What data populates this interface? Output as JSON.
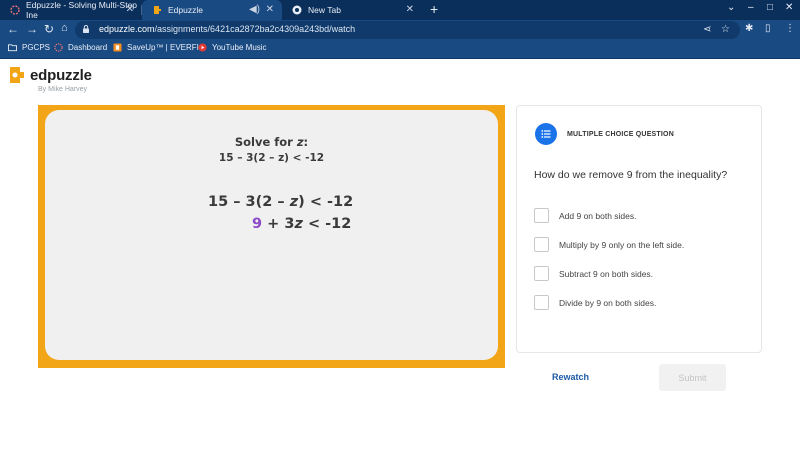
{
  "browser": {
    "tabs": [
      {
        "title": "Edpuzzle - Solving Multi-Step Ine",
        "icon": "edpuzzle-loading-icon"
      },
      {
        "title": "Edpuzzle",
        "icon": "edpuzzle-icon"
      },
      {
        "title": "New Tab",
        "icon": "chrome-icon"
      }
    ],
    "new_tab": "+",
    "url_host": "edpuzzle.com",
    "url_path": "/assignments/6421ca2872ba2c4309a243bd/watch",
    "bookmarks": [
      {
        "label": "PGCPS",
        "icon": "folder-icon"
      },
      {
        "label": "Dashboard",
        "icon": "dashboard-icon"
      },
      {
        "label": "SaveUp™ | EVERFI...",
        "icon": "saveup-icon"
      },
      {
        "label": "YouTube Music",
        "icon": "youtube-music-icon"
      }
    ],
    "colors": {
      "frame": "#0b2f5b",
      "toolbar": "#1a4a82"
    }
  },
  "app": {
    "brand": "edpuzzle",
    "byline": "By Mike Harvey",
    "brand_color": "#f2a516"
  },
  "video": {
    "title_prefix": "Solve for ",
    "title_var": "z",
    "title_suffix": ":",
    "equation": "15 – 3(2 – z) < -12",
    "step1_a": "15 – 3(2 – ",
    "step1_var": "z",
    "step1_b": ") < -12",
    "step2_highlight": "9",
    "step2_a": " + 3",
    "step2_var": "z",
    "step2_b": " < -12"
  },
  "question": {
    "type_label": "MULTIPLE CHOICE QUESTION",
    "text": "How do we remove 9 from the inequality?",
    "options": [
      "Add 9 on both sides.",
      "Multiply by 9 only on the left side.",
      "Subtract 9 on both sides.",
      "Divide by 9 on both sides."
    ],
    "accent": "#1a73e8"
  },
  "actions": {
    "rewatch": "Rewatch",
    "submit": "Submit"
  }
}
